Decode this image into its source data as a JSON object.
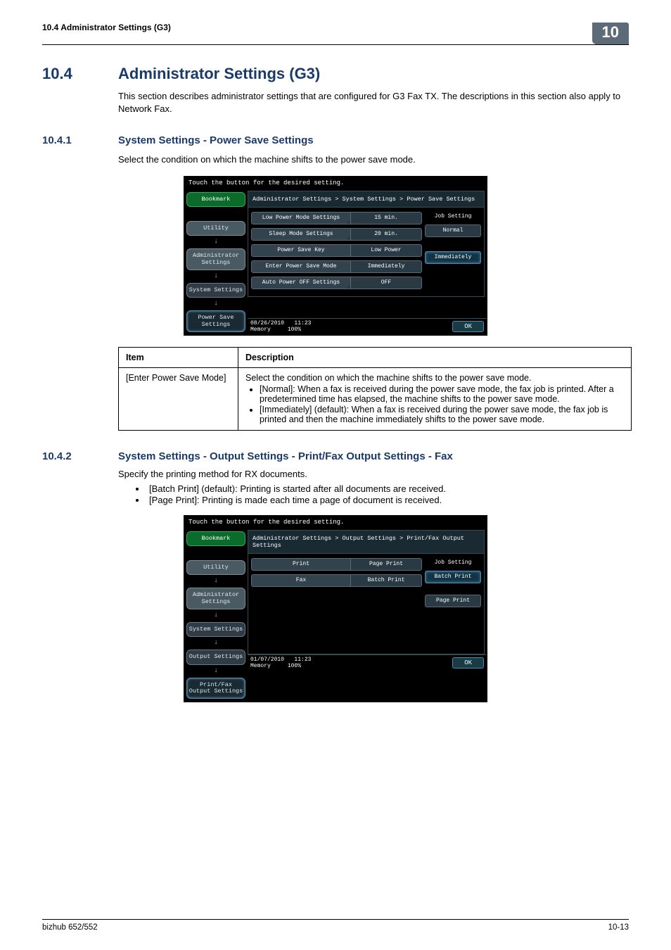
{
  "runhead": {
    "left": "10.4    Administrator Settings (G3)",
    "chapter": "10"
  },
  "h1": {
    "num": "10.4",
    "title": "Administrator Settings (G3)"
  },
  "intro": "This section describes administrator settings that are configured for G3 Fax TX. The descriptions in this section also apply to Network Fax.",
  "s1": {
    "num": "10.4.1",
    "title": "System Settings - Power Save Settings",
    "body": "Select the condition on which the machine shifts to the power save mode."
  },
  "ss1": {
    "topbar": "Touch the button for the desired setting.",
    "bookmark": "Bookmark",
    "nav": {
      "utility": "Utility",
      "admin": "Administrator Settings",
      "system": "System Settings",
      "active": "Power Save Settings"
    },
    "crumbs": "Administrator Settings > System Settings > Power Save Settings",
    "rows": {
      "low": {
        "label": "Low Power Mode Settings",
        "val": "15 min."
      },
      "sleep": {
        "label": "Sleep Mode Settings",
        "val": "20 min."
      },
      "key": {
        "label": "Power Save Key",
        "val": "Low Power"
      },
      "enter": {
        "label": "Enter Power Save Mode",
        "val": "Immediately"
      },
      "auto": {
        "label": "Auto Power OFF Settings",
        "val": "OFF"
      }
    },
    "side": {
      "title": "Job Setting",
      "normal": "Normal",
      "immed": "Immediately"
    },
    "footer": {
      "date": "08/26/2010",
      "time": "11:23",
      "mem": "Memory",
      "pct": "100%",
      "ok": "OK"
    }
  },
  "table1": {
    "head": {
      "c1": "Item",
      "c2": "Description"
    },
    "row": {
      "item": "[Enter Power Save Mode]",
      "lead": "Select the condition on which the machine shifts to the power save mode.",
      "b1": "[Normal]: When a fax is received during the power save mode, the fax job is printed. After a predetermined time has elapsed, the machine shifts to the power save mode.",
      "b2": "[Immediately] (default): When a fax is received during the power save mode, the fax job is printed and then the machine immediately shifts to the power save mode."
    }
  },
  "s2": {
    "num": "10.4.2",
    "title": "System Settings - Output Settings - Print/Fax Output Settings - Fax",
    "body": "Specify the printing method for RX documents.",
    "b1": "[Batch Print] (default): Printing is started after all documents are received.",
    "b2": "[Page Print]: Printing is made each time a page of document is received."
  },
  "ss2": {
    "topbar": "Touch the button for the desired setting.",
    "bookmark": "Bookmark",
    "nav": {
      "utility": "Utility",
      "admin": "Administrator Settings",
      "system": "System Settings",
      "output": "Output Settings",
      "active": "Print/Fax Output Settings"
    },
    "crumbs": "Administrator Settings > Output Settings > Print/Fax Output Settings",
    "rows": {
      "print": {
        "label": "Print",
        "val": "Page Print"
      },
      "fax": {
        "label": "Fax",
        "val": "Batch Print"
      }
    },
    "side": {
      "title": "Job Setting",
      "batch": "Batch Print",
      "page": "Page Print"
    },
    "footer": {
      "date": "01/07/2010",
      "time": "11:23",
      "mem": "Memory",
      "pct": "100%",
      "ok": "OK"
    }
  },
  "footer": {
    "left": "bizhub 652/552",
    "right": "10-13"
  }
}
